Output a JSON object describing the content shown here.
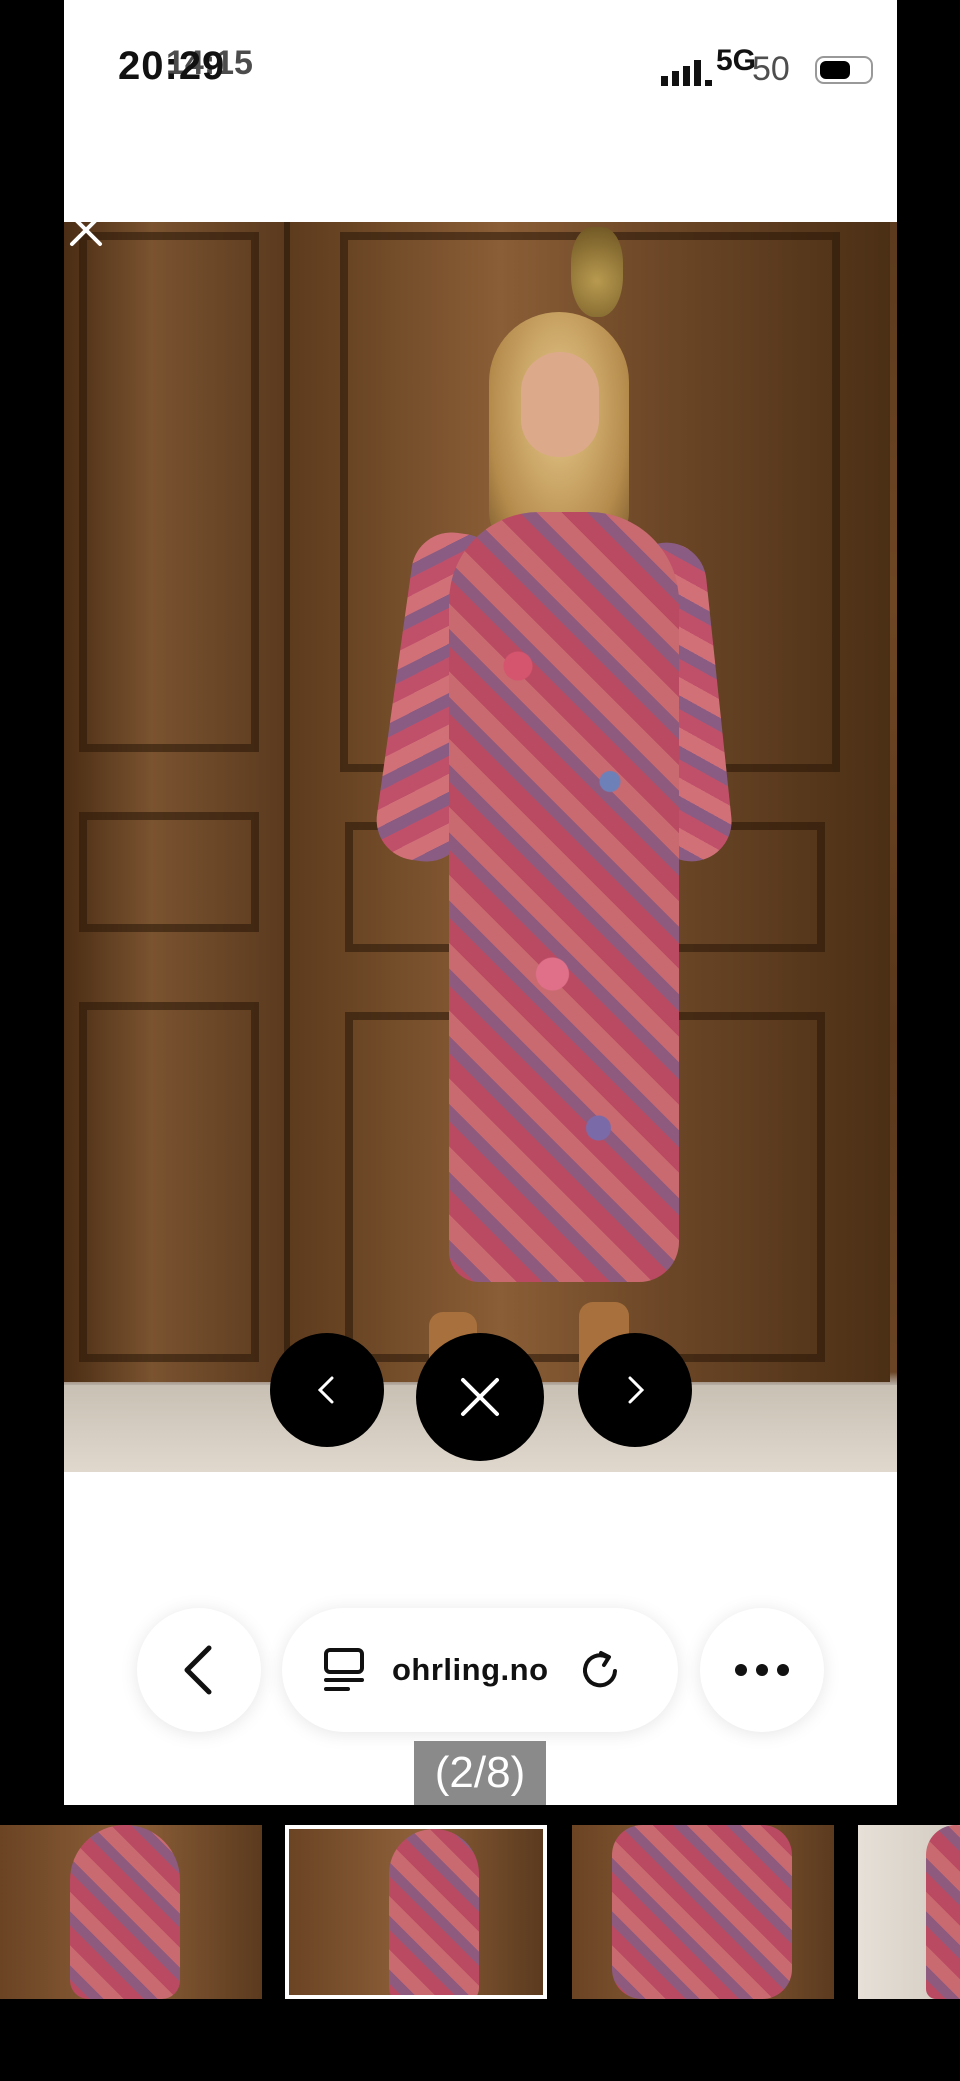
{
  "status_bar": {
    "time": "20:29",
    "time_overlay": "14:15",
    "network": "5G",
    "network_overlay": "50"
  },
  "viewer": {
    "close_label": "×",
    "prev_label": "‹",
    "next_label": "›",
    "dismiss_label": "✕"
  },
  "browser": {
    "back_icon": "chevron-left-icon",
    "tabs_icon": "tabs-icon",
    "url": "ohrling.no",
    "reload_icon": "reload-icon",
    "more_icon": "more-icon"
  },
  "gallery": {
    "counter": "(2/8)",
    "current_index": 2,
    "total": 8,
    "thumbnails": [
      {
        "name": "thumbnail-1"
      },
      {
        "name": "thumbnail-2"
      },
      {
        "name": "thumbnail-3"
      },
      {
        "name": "thumbnail-4"
      }
    ]
  },
  "colors": {
    "accent": "#000000",
    "frame": "#ffffff",
    "counter_bg": "#8a8a8a"
  }
}
